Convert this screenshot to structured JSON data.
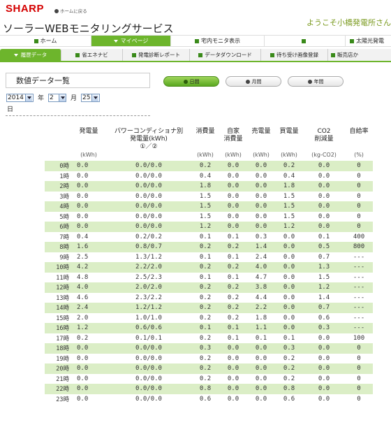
{
  "header": {
    "logo": "SHARP",
    "home_link": "ホームに戻る",
    "site_title": "ソーラーWEBモニタリングサービス",
    "welcome": "ようこそ小橋発電所さん"
  },
  "nav_main": [
    {
      "label": "ホーム",
      "active": false
    },
    {
      "label": "マイページ",
      "active": true
    },
    {
      "label": "宅内モニタ表示",
      "active": false
    },
    {
      "label": "",
      "active": false
    },
    {
      "label": "太陽光発電",
      "active": false
    }
  ],
  "nav_sub": [
    {
      "label": "履歴データ",
      "active": true
    },
    {
      "label": "省エネナビ",
      "active": false
    },
    {
      "label": "発電診断レポート",
      "active": false
    },
    {
      "label": "データダウンロード",
      "active": false
    },
    {
      "label": "待ち受け画像登録",
      "active": false
    },
    {
      "label": "販売店か",
      "active": false
    }
  ],
  "section_title": "数値データ一覧",
  "period_buttons": [
    {
      "label": "日間",
      "active": true
    },
    {
      "label": "月間",
      "active": false
    },
    {
      "label": "年間",
      "active": false
    }
  ],
  "date_selector": {
    "year": "2014",
    "year_suffix": "年",
    "month": "2",
    "month_suffix": "月",
    "day": "25",
    "day_suffix": "日"
  },
  "table": {
    "headers": [
      {
        "line1": "発電量",
        "line2": "",
        "unit": "(kWh)"
      },
      {
        "line1": "パワーコンディショナ別",
        "line2": "発電量(kWh)",
        "line3": "①／②",
        "unit": ""
      },
      {
        "line1": "消費量",
        "line2": "",
        "unit": "(kWh)"
      },
      {
        "line1": "自家",
        "line2": "消費量",
        "unit": "(kWh)"
      },
      {
        "line1": "売電量",
        "line2": "",
        "unit": "(kWh)"
      },
      {
        "line1": "買電量",
        "line2": "",
        "unit": "(kWh)"
      },
      {
        "line1": "CO2",
        "line2": "削減量",
        "unit": "(kg-CO2)"
      },
      {
        "line1": "自給率",
        "line2": "",
        "unit": "(%)"
      }
    ],
    "rows": [
      {
        "hour": "0時",
        "gen": "0.0",
        "pcs": "0.0/0.0",
        "cons": "0.2",
        "self": "0.0",
        "sell": "0.0",
        "buy": "0.2",
        "co2": "0.0",
        "rate": "0"
      },
      {
        "hour": "1時",
        "gen": "0.0",
        "pcs": "0.0/0.0",
        "cons": "0.4",
        "self": "0.0",
        "sell": "0.0",
        "buy": "0.4",
        "co2": "0.0",
        "rate": "0"
      },
      {
        "hour": "2時",
        "gen": "0.0",
        "pcs": "0.0/0.0",
        "cons": "1.8",
        "self": "0.0",
        "sell": "0.0",
        "buy": "1.8",
        "co2": "0.0",
        "rate": "0"
      },
      {
        "hour": "3時",
        "gen": "0.0",
        "pcs": "0.0/0.0",
        "cons": "1.5",
        "self": "0.0",
        "sell": "0.0",
        "buy": "1.5",
        "co2": "0.0",
        "rate": "0"
      },
      {
        "hour": "4時",
        "gen": "0.0",
        "pcs": "0.0/0.0",
        "cons": "1.5",
        "self": "0.0",
        "sell": "0.0",
        "buy": "1.5",
        "co2": "0.0",
        "rate": "0"
      },
      {
        "hour": "5時",
        "gen": "0.0",
        "pcs": "0.0/0.0",
        "cons": "1.5",
        "self": "0.0",
        "sell": "0.0",
        "buy": "1.5",
        "co2": "0.0",
        "rate": "0"
      },
      {
        "hour": "6時",
        "gen": "0.0",
        "pcs": "0.0/0.0",
        "cons": "1.2",
        "self": "0.0",
        "sell": "0.0",
        "buy": "1.2",
        "co2": "0.0",
        "rate": "0"
      },
      {
        "hour": "7時",
        "gen": "0.4",
        "pcs": "0.2/0.2",
        "cons": "0.1",
        "self": "0.1",
        "sell": "0.3",
        "buy": "0.0",
        "co2": "0.1",
        "rate": "400"
      },
      {
        "hour": "8時",
        "gen": "1.6",
        "pcs": "0.8/0.7",
        "cons": "0.2",
        "self": "0.2",
        "sell": "1.4",
        "buy": "0.0",
        "co2": "0.5",
        "rate": "800"
      },
      {
        "hour": "9時",
        "gen": "2.5",
        "pcs": "1.3/1.2",
        "cons": "0.1",
        "self": "0.1",
        "sell": "2.4",
        "buy": "0.0",
        "co2": "0.7",
        "rate": "---"
      },
      {
        "hour": "10時",
        "gen": "4.2",
        "pcs": "2.2/2.0",
        "cons": "0.2",
        "self": "0.2",
        "sell": "4.0",
        "buy": "0.0",
        "co2": "1.3",
        "rate": "---"
      },
      {
        "hour": "11時",
        "gen": "4.8",
        "pcs": "2.5/2.3",
        "cons": "0.1",
        "self": "0.1",
        "sell": "4.7",
        "buy": "0.0",
        "co2": "1.5",
        "rate": "---"
      },
      {
        "hour": "12時",
        "gen": "4.0",
        "pcs": "2.0/2.0",
        "cons": "0.2",
        "self": "0.2",
        "sell": "3.8",
        "buy": "0.0",
        "co2": "1.2",
        "rate": "---"
      },
      {
        "hour": "13時",
        "gen": "4.6",
        "pcs": "2.3/2.2",
        "cons": "0.2",
        "self": "0.2",
        "sell": "4.4",
        "buy": "0.0",
        "co2": "1.4",
        "rate": "---"
      },
      {
        "hour": "14時",
        "gen": "2.4",
        "pcs": "1.2/1.2",
        "cons": "0.2",
        "self": "0.2",
        "sell": "2.2",
        "buy": "0.0",
        "co2": "0.7",
        "rate": "---"
      },
      {
        "hour": "15時",
        "gen": "2.0",
        "pcs": "1.0/1.0",
        "cons": "0.2",
        "self": "0.2",
        "sell": "1.8",
        "buy": "0.0",
        "co2": "0.6",
        "rate": "---"
      },
      {
        "hour": "16時",
        "gen": "1.2",
        "pcs": "0.6/0.6",
        "cons": "0.1",
        "self": "0.1",
        "sell": "1.1",
        "buy": "0.0",
        "co2": "0.3",
        "rate": "---"
      },
      {
        "hour": "17時",
        "gen": "0.2",
        "pcs": "0.1/0.1",
        "cons": "0.2",
        "self": "0.1",
        "sell": "0.1",
        "buy": "0.1",
        "co2": "0.0",
        "rate": "100"
      },
      {
        "hour": "18時",
        "gen": "0.0",
        "pcs": "0.0/0.0",
        "cons": "0.3",
        "self": "0.0",
        "sell": "0.0",
        "buy": "0.3",
        "co2": "0.0",
        "rate": "0"
      },
      {
        "hour": "19時",
        "gen": "0.0",
        "pcs": "0.0/0.0",
        "cons": "0.2",
        "self": "0.0",
        "sell": "0.0",
        "buy": "0.2",
        "co2": "0.0",
        "rate": "0"
      },
      {
        "hour": "20時",
        "gen": "0.0",
        "pcs": "0.0/0.0",
        "cons": "0.2",
        "self": "0.0",
        "sell": "0.0",
        "buy": "0.2",
        "co2": "0.0",
        "rate": "0"
      },
      {
        "hour": "21時",
        "gen": "0.0",
        "pcs": "0.0/0.0",
        "cons": "0.2",
        "self": "0.0",
        "sell": "0.0",
        "buy": "0.2",
        "co2": "0.0",
        "rate": "0"
      },
      {
        "hour": "22時",
        "gen": "0.0",
        "pcs": "0.0/0.0",
        "cons": "0.8",
        "self": "0.0",
        "sell": "0.0",
        "buy": "0.8",
        "co2": "0.0",
        "rate": "0"
      },
      {
        "hour": "23時",
        "gen": "0.0",
        "pcs": "0.0/0.0",
        "cons": "0.6",
        "self": "0.0",
        "sell": "0.0",
        "buy": "0.6",
        "co2": "0.0",
        "rate": "0"
      }
    ]
  },
  "colors": {
    "brand_red": "#d40000",
    "accent_green": "#6db52c",
    "row_stripe": "#dbeec6",
    "welcome_text": "#7a9a1e"
  }
}
